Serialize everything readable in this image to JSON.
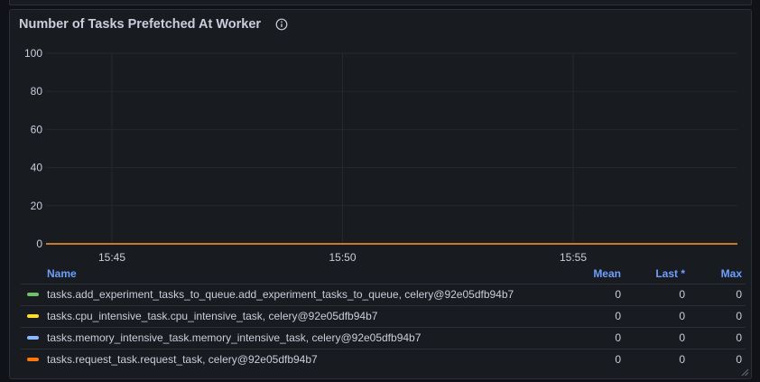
{
  "panel": {
    "title": "Number of Tasks Prefetched At Worker",
    "info_icon": "info-circle-icon",
    "resize_icon": "resize-handle-icon"
  },
  "chart_data": {
    "type": "line",
    "title": "Number of Tasks Prefetched At Worker",
    "xlabel": "",
    "ylabel": "",
    "ylim": [
      0,
      100
    ],
    "y_ticks": [
      "0",
      "20",
      "40",
      "60",
      "80",
      "100"
    ],
    "x_ticks": [
      "15:45",
      "15:50",
      "15:55"
    ],
    "grid": true,
    "legend_placement": "bottom",
    "series": [
      {
        "name": "tasks.add_experiment_tasks_to_queue.add_experiment_tasks_to_queue, celery@92e05dfb94b7",
        "color": "#73bf69",
        "values": [
          0,
          0
        ]
      },
      {
        "name": "tasks.cpu_intensive_task.cpu_intensive_task, celery@92e05dfb94b7",
        "color": "#fade2a",
        "values": [
          0,
          0
        ]
      },
      {
        "name": "tasks.memory_intensive_task.memory_intensive_task, celery@92e05dfb94b7",
        "color": "#8ab8ff",
        "values": [
          0,
          0
        ]
      },
      {
        "name": "tasks.request_task.request_task, celery@92e05dfb94b7",
        "color": "#ff780a",
        "values": [
          0,
          0
        ]
      }
    ]
  },
  "legend": {
    "headers": {
      "name": "Name",
      "mean": "Mean",
      "last": "Last *",
      "max": "Max"
    },
    "rows": [
      {
        "name": "tasks.add_experiment_tasks_to_queue.add_experiment_tasks_to_queue, celery@92e05dfb94b7",
        "color": "#73bf69",
        "mean": "0",
        "last": "0",
        "max": "0"
      },
      {
        "name": "tasks.cpu_intensive_task.cpu_intensive_task, celery@92e05dfb94b7",
        "color": "#fade2a",
        "mean": "0",
        "last": "0",
        "max": "0"
      },
      {
        "name": "tasks.memory_intensive_task.memory_intensive_task, celery@92e05dfb94b7",
        "color": "#8ab8ff",
        "mean": "0",
        "last": "0",
        "max": "0"
      },
      {
        "name": "tasks.request_task.request_task, celery@92e05dfb94b7",
        "color": "#ff780a",
        "mean": "0",
        "last": "0",
        "max": "0"
      }
    ]
  }
}
